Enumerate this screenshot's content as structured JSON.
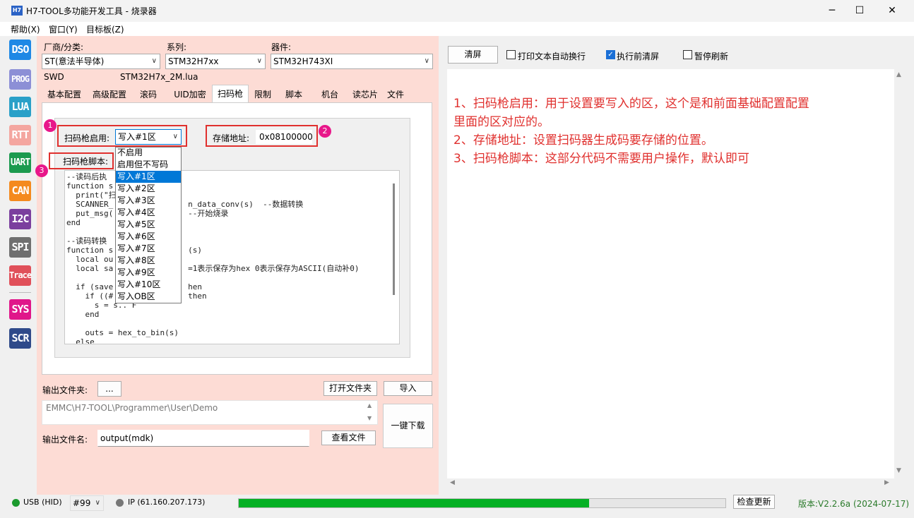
{
  "window": {
    "icon_text": "H7",
    "title": "H7-TOOL多功能开发工具 - 烧录器",
    "min": "─",
    "max": "☐",
    "close": "✕"
  },
  "menu": [
    "帮助(X)",
    "窗口(Y)",
    "目标板(Z)"
  ],
  "sidebar": [
    {
      "label": "DSO",
      "color": "#1e88e5"
    },
    {
      "label": "PROG",
      "color": "#8c8fd6"
    },
    {
      "label": "LUA",
      "color": "#29a0c8"
    },
    {
      "label": "RTT",
      "color": "#f4a6a0"
    },
    {
      "label": "UART",
      "color": "#1b9a4f"
    },
    {
      "label": "CAN",
      "color": "#f48a1e"
    },
    {
      "label": "I2C",
      "color": "#7b3f9e"
    },
    {
      "label": "SPI",
      "color": "#6f6f6f"
    },
    {
      "label": "Trace",
      "color": "#e0505a"
    },
    {
      "label": "SYS",
      "color": "#e0168a"
    },
    {
      "label": "SCR",
      "color": "#2f4a8a"
    }
  ],
  "selectors": {
    "vendor_label": "厂商/分类:",
    "vendor_value": "ST(意法半导体)",
    "series_label": "系列:",
    "series_value": "STM32H7xx",
    "device_label": "器件:",
    "device_value": "STM32H743XI",
    "interface": "SWD",
    "lua_file": "STM32H7x_2M.lua"
  },
  "tabs": [
    "基本配置",
    "高级配置",
    "滚码",
    "UID加密",
    "扫码枪",
    "限制",
    "脚本",
    "机台",
    "读芯片",
    "文件"
  ],
  "scanner": {
    "enable_label": "扫码枪启用:",
    "enable_value": "写入#1区",
    "addr_label": "存储地址:",
    "addr_value": "0x08100000",
    "script_label": "扫码枪脚本:",
    "badges": [
      "1",
      "2",
      "3"
    ],
    "options": [
      "不启用",
      "启用但不写码",
      "写入#1区",
      "写入#2区",
      "写入#3区",
      "写入#4区",
      "写入#5区",
      "写入#6区",
      "写入#7区",
      "写入#8区",
      "写入#9区",
      "写入#10区",
      "写入OB区"
    ],
    "code": "--读码后执\nfunction s\n  print(\"扫\n  SCANNER_                n_data_conv(s)  --数据转换\n  put_msg(                --开始烧录\nend\n\n--读码转换\nfunction s                (s)\n  local ou\n  local sa                =1表示保存为hex 0表示保存为ASCII(自动补0)\n\n  if (save                hen\n    if ((#                then\n      s = s.. F\n    end\n\n    outs = hex_to_bin(s)\n  else"
  },
  "output": {
    "folder_label": "输出文件夹:",
    "browse": "...",
    "open_folder": "打开文件夹",
    "import": "导入",
    "path": "EMMC\\H7-TOOL\\Programmer\\User\\Demo",
    "name_label": "输出文件名:",
    "name_value": "output(mdk)",
    "view_file": "查看文件",
    "download": "一键下载"
  },
  "right": {
    "clear": "清屏",
    "opt1": "打印文本自动换行",
    "opt1_checked": false,
    "opt2": "执行前清屏",
    "opt2_checked": true,
    "opt3": "暂停刷新",
    "opt3_checked": false,
    "notes": [
      "1、扫码枪启用：用于设置要写入的区，这个是和前面基础配置配置",
      "里面的区对应的。",
      "2、存储地址：设置扫码器生成码要存储的位置。",
      "3、扫码枪脚本：这部分代码不需要用户操作，默认即可"
    ]
  },
  "status": {
    "usb": "USB (HID)",
    "usb_color": "#1b9a2e",
    "port": "#99",
    "ip": "IP (61.160.207.173)",
    "ip_color": "#777777",
    "progress": 0.72,
    "check_update": "检查更新",
    "version": "版本:V2.2.6a (2024-07-17)"
  }
}
